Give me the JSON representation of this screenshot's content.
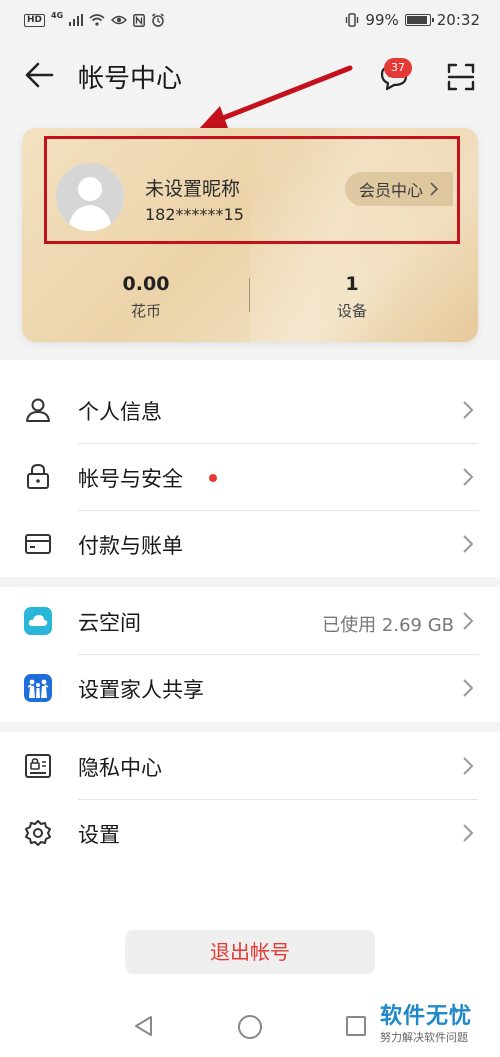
{
  "status_bar": {
    "left_labels": [
      "HD",
      "4G"
    ],
    "battery": "99%",
    "time": "20:32"
  },
  "header": {
    "title": "帐号中心",
    "message_count": "37"
  },
  "account_card": {
    "nickname": "未设置昵称",
    "phone": "182******15",
    "vip_label": "会员中心",
    "stats": [
      {
        "value": "0.00",
        "label": "花币"
      },
      {
        "value": "1",
        "label": "设备"
      }
    ]
  },
  "menu": {
    "personal_info": "个人信息",
    "account_security": "帐号与安全",
    "payment": "付款与账单",
    "cloud": "云空间",
    "cloud_usage": "已使用 2.69 GB",
    "family_share": "设置家人共享",
    "privacy": "隐私中心",
    "settings": "设置"
  },
  "logout_label": "退出帐号",
  "watermark": {
    "title": "软件无忧",
    "subtitle": "努力解决软件问题"
  },
  "colors": {
    "accent_red": "#e53935",
    "highlight_red": "#c3121c",
    "card_gold": "#ecd3a9",
    "watermark_blue": "#1e88c9"
  },
  "icons": [
    "back-arrow-icon",
    "message-icon",
    "scan-icon",
    "person-icon",
    "lock-icon",
    "card-icon",
    "cloud-icon",
    "family-icon",
    "privacy-icon",
    "gear-icon",
    "chevron-right-icon"
  ]
}
